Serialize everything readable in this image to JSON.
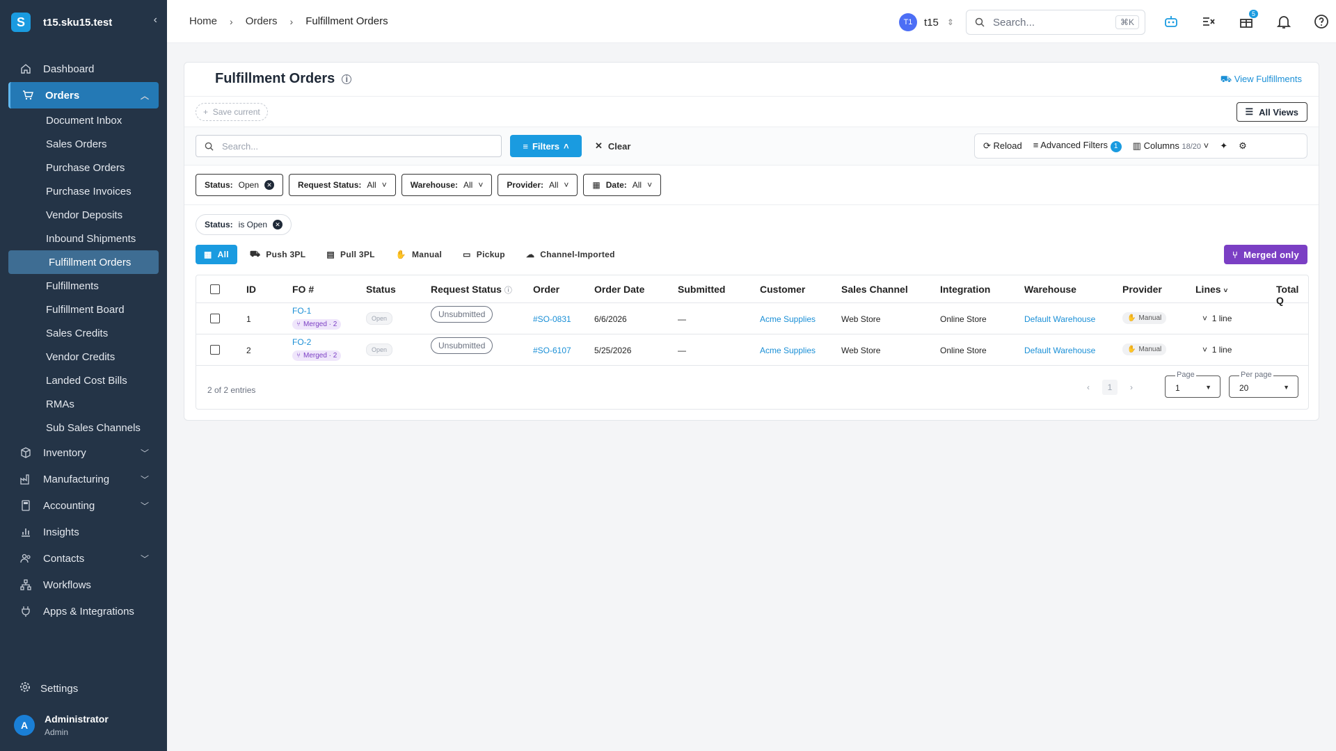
{
  "app": {
    "name": "t15.sku15.test",
    "logo_letter": "S",
    "collapse_icon": "‹"
  },
  "sidebar": {
    "top_items": [
      {
        "label": "Dashboard",
        "icon": "home-icon"
      },
      {
        "label": "Orders",
        "icon": "cart-icon"
      }
    ],
    "orders_sub": [
      "Document Inbox",
      "Sales Orders",
      "Purchase Orders",
      "Purchase Invoices",
      "Vendor Deposits",
      "Inbound Shipments",
      "Fulfillment Orders",
      "Fulfillments",
      "Fulfillment Board",
      "Sales Credits",
      "Vendor Credits",
      "Landed Cost Bills",
      "RMAs",
      "Sub Sales Channels"
    ],
    "bottom_items": [
      {
        "label": "Inventory",
        "icon": "box-icon"
      },
      {
        "label": "Manufacturing",
        "icon": "factory-icon"
      },
      {
        "label": "Accounting",
        "icon": "calculator-icon"
      },
      {
        "label": "Insights",
        "icon": "bar-chart-icon"
      },
      {
        "label": "Contacts",
        "icon": "users-icon"
      },
      {
        "label": "Workflows",
        "icon": "workflow-icon"
      },
      {
        "label": "Apps & Integrations",
        "icon": "plug-icon"
      }
    ],
    "settings": "Settings",
    "user": {
      "initial": "A",
      "name": "Administrator",
      "role": "Admin"
    }
  },
  "topbar": {
    "breadcrumb": [
      "Home",
      "Orders",
      "Fulfillment Orders"
    ],
    "tenant": {
      "badge": "T1",
      "name": "t15"
    },
    "search_placeholder": "Search...",
    "search_kbd": "⌘K",
    "gift_badge": "5"
  },
  "page": {
    "title": "Fulfillment Orders",
    "view_fulfillments": "View Fulfillments",
    "save_current": "Save current",
    "all_views": "All Views",
    "search_placeholder": "Search...",
    "filters": "Filters",
    "clear": "Clear",
    "reload": "Reload",
    "advanced_filters": "Advanced Filters",
    "advanced_count": "1",
    "columns": "Columns",
    "columns_count": "18/20",
    "chips": [
      {
        "key": "Status:",
        "val": "Open",
        "type": "remove"
      },
      {
        "key": "Request Status:",
        "val": "All",
        "type": "drop"
      },
      {
        "key": "Warehouse:",
        "val": "All",
        "type": "drop"
      },
      {
        "key": "Provider:",
        "val": "All",
        "type": "drop"
      },
      {
        "key": "Date:",
        "val": "All",
        "type": "drop"
      }
    ],
    "status_pill": {
      "key": "Status:",
      "val": "is Open"
    },
    "tabs": [
      "All",
      "Push 3PL",
      "Pull 3PL",
      "Manual",
      "Pickup",
      "Channel-Imported"
    ],
    "merged_only": "Merged only"
  },
  "table": {
    "headers": [
      "ID",
      "FO #",
      "Status",
      "Request Status",
      "Order",
      "Order Date",
      "Submitted",
      "Customer",
      "Sales Channel",
      "Integration",
      "Warehouse",
      "Provider",
      "Lines",
      "Total Q"
    ],
    "rows": [
      {
        "id": "1",
        "fo": "FO-1",
        "merged": "Merged · 2",
        "status": "Open",
        "request": "Unsubmitted",
        "order": "#SO-0831",
        "date": "6/6/2026",
        "submitted": "—",
        "customer": "Acme Supplies",
        "channel": "Web Store",
        "integration": "Online Store",
        "warehouse": "Default Warehouse",
        "provider": "Manual",
        "lines": "1 line"
      },
      {
        "id": "2",
        "fo": "FO-2",
        "merged": "Merged · 2",
        "status": "Open",
        "request": "Unsubmitted",
        "order": "#SO-6107",
        "date": "5/25/2026",
        "submitted": "—",
        "customer": "Acme Supplies",
        "channel": "Web Store",
        "integration": "Online Store",
        "warehouse": "Default Warehouse",
        "provider": "Manual",
        "lines": "1 line"
      }
    ],
    "entries": "2 of 2 entries",
    "page_label": "Page",
    "page_value": "1",
    "current_page": "1",
    "per_page_label": "Per page",
    "per_page_value": "20"
  },
  "colors": {
    "accent": "#1a9be0",
    "sidebar": "#243447",
    "merged": "#7b3fc4"
  }
}
